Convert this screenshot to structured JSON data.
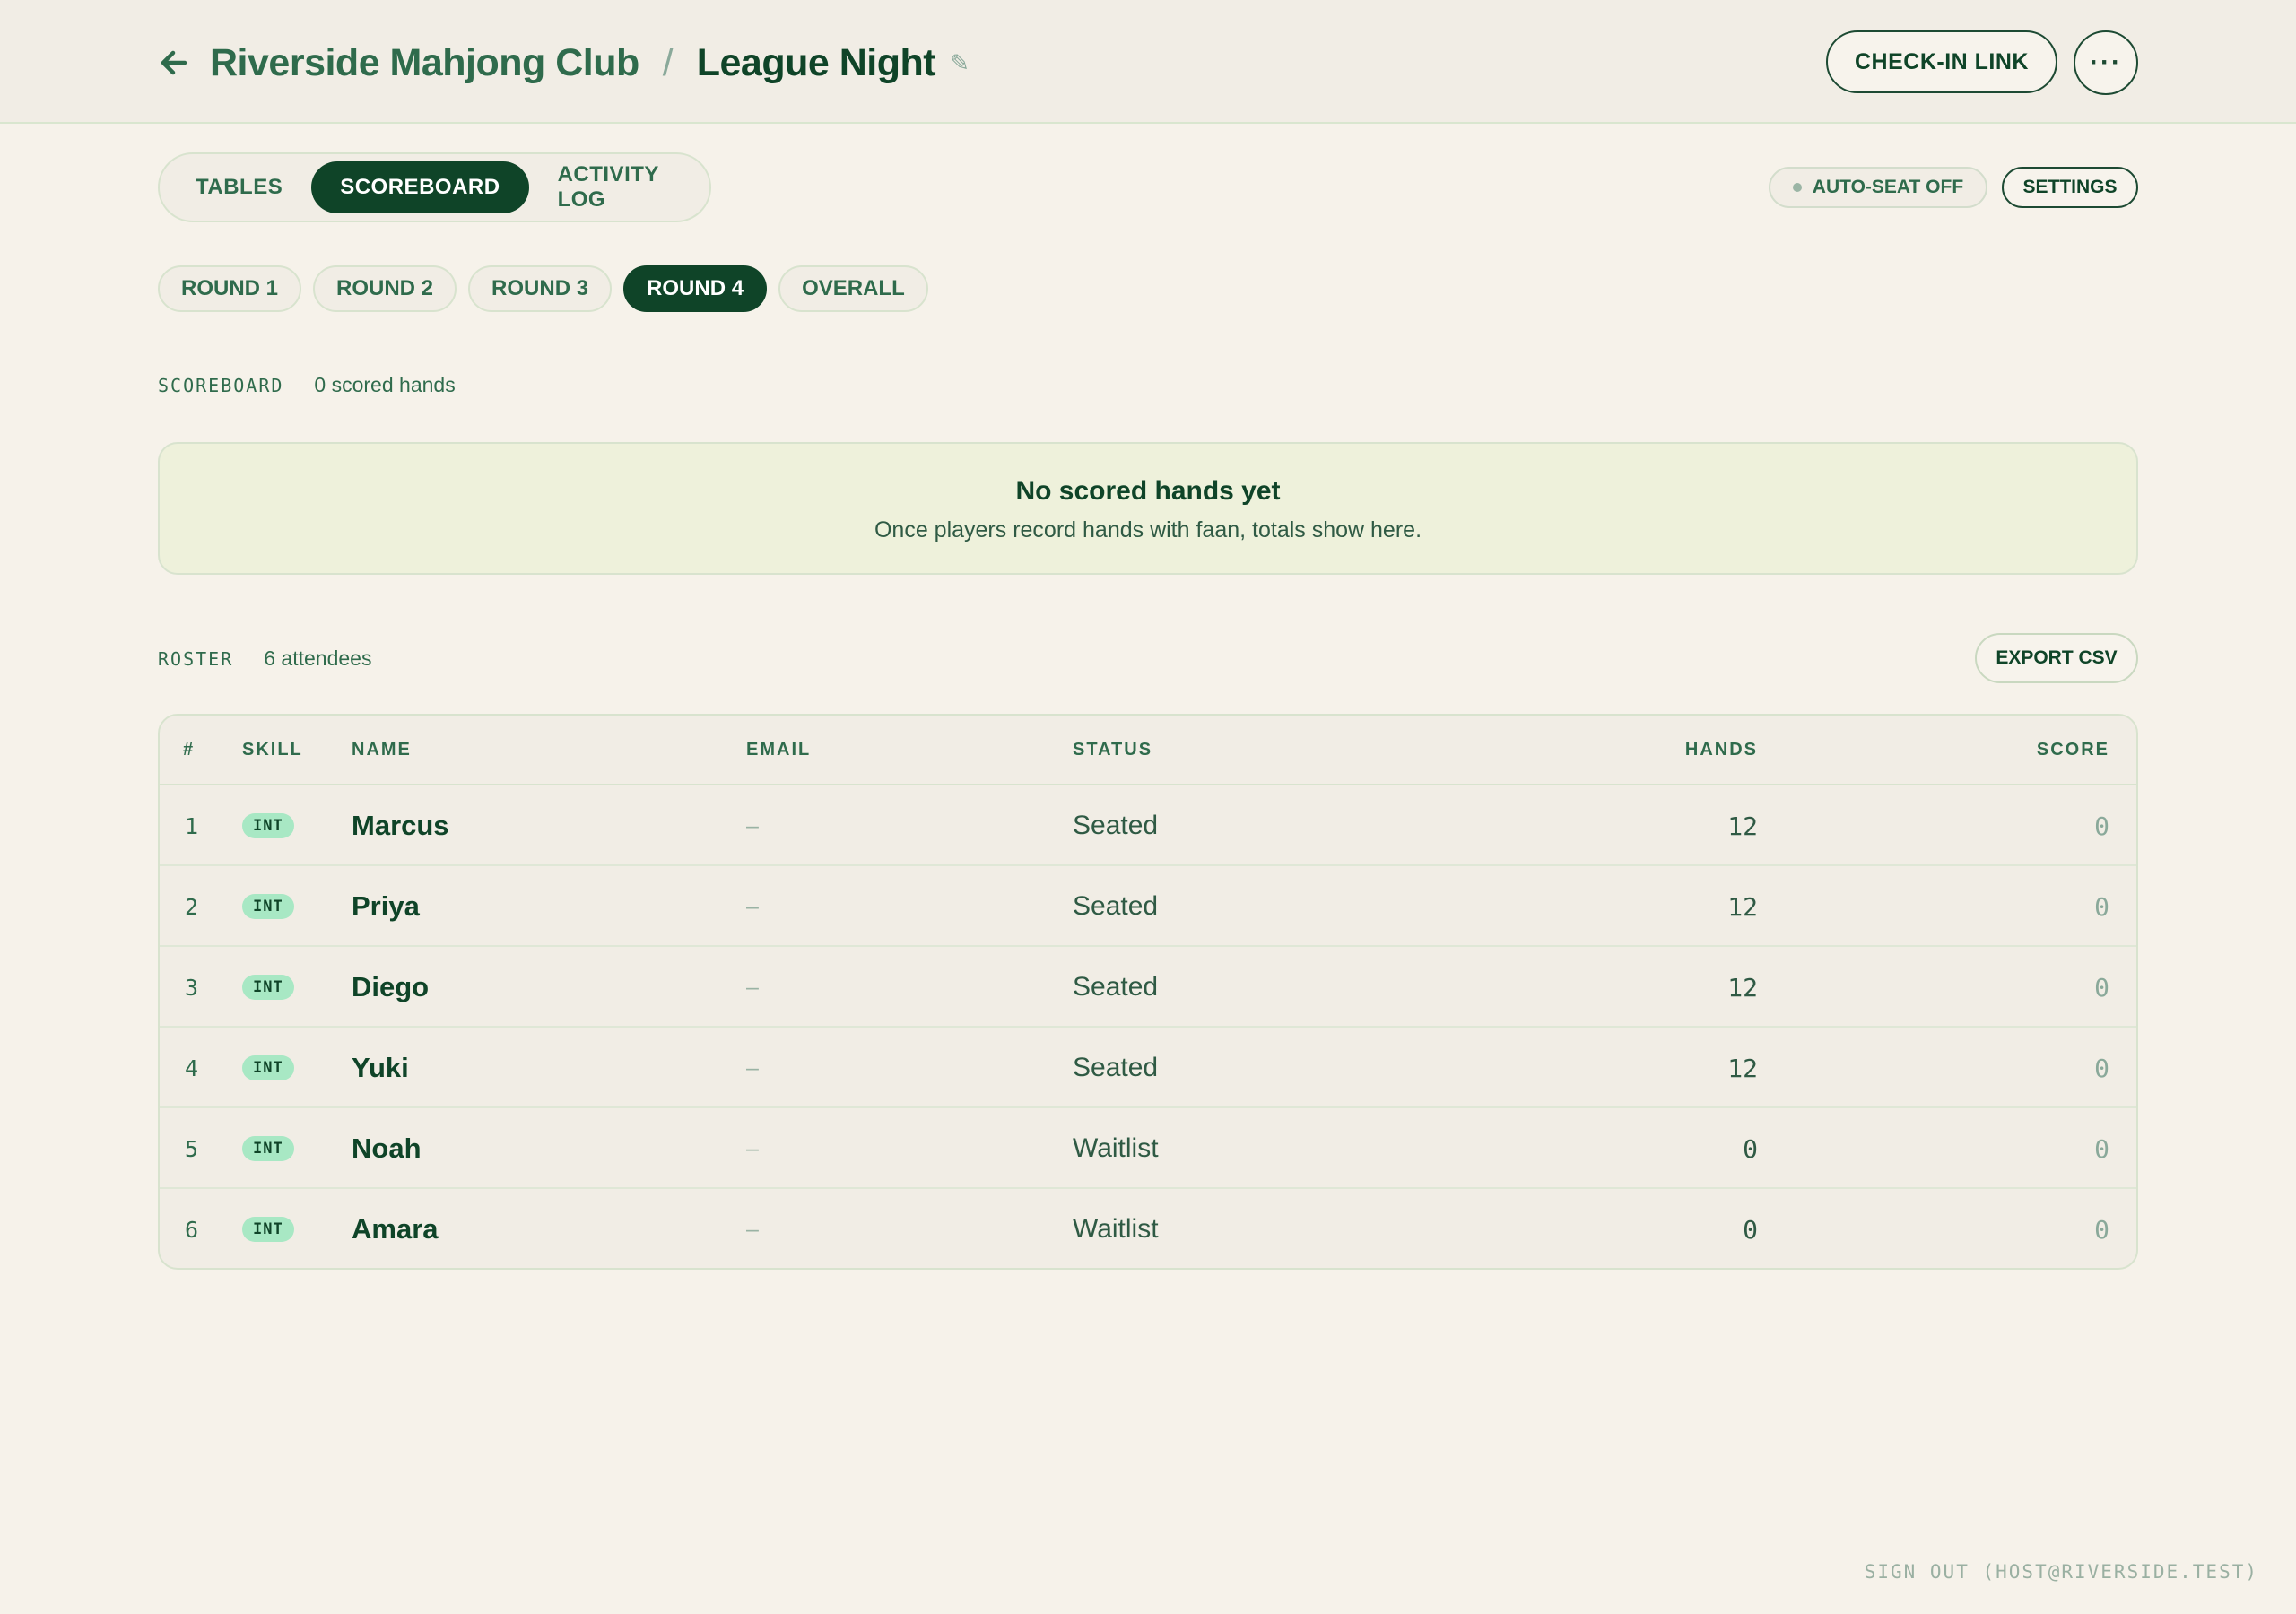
{
  "header": {
    "club": "Riverside Mahjong Club",
    "separator": "/",
    "event": "League Night",
    "checkin_label": "CHECK-IN LINK",
    "more_label": "···"
  },
  "tabs": [
    {
      "label": "TABLES",
      "active": false
    },
    {
      "label": "SCOREBOARD",
      "active": true
    },
    {
      "label": "ACTIVITY LOG",
      "active": false
    }
  ],
  "controls": {
    "autoseat_label": "AUTO-SEAT OFF",
    "settings_label": "SETTINGS"
  },
  "rounds": [
    {
      "label": "ROUND 1",
      "active": false
    },
    {
      "label": "ROUND 2",
      "active": false
    },
    {
      "label": "ROUND 3",
      "active": false
    },
    {
      "label": "ROUND 4",
      "active": true
    },
    {
      "label": "OVERALL",
      "active": false
    }
  ],
  "scoreboard": {
    "label": "SCOREBOARD",
    "count": "0 scored hands",
    "empty_title": "No scored hands yet",
    "empty_sub": "Once players record hands with faan, totals show here."
  },
  "roster": {
    "label": "ROSTER",
    "count": "6 attendees",
    "export_label": "EXPORT CSV",
    "columns": {
      "num": "#",
      "skill": "SKILL",
      "name": "NAME",
      "email": "EMAIL",
      "status": "STATUS",
      "hands": "HANDS",
      "score": "SCORE"
    },
    "rows": [
      {
        "num": "1",
        "skill": "INT",
        "name": "Marcus",
        "email": "–",
        "status": "Seated",
        "hands": "12",
        "score": "0"
      },
      {
        "num": "2",
        "skill": "INT",
        "name": "Priya",
        "email": "–",
        "status": "Seated",
        "hands": "12",
        "score": "0"
      },
      {
        "num": "3",
        "skill": "INT",
        "name": "Diego",
        "email": "–",
        "status": "Seated",
        "hands": "12",
        "score": "0"
      },
      {
        "num": "4",
        "skill": "INT",
        "name": "Yuki",
        "email": "–",
        "status": "Seated",
        "hands": "12",
        "score": "0"
      },
      {
        "num": "5",
        "skill": "INT",
        "name": "Noah",
        "email": "–",
        "status": "Waitlist",
        "hands": "0",
        "score": "0"
      },
      {
        "num": "6",
        "skill": "INT",
        "name": "Amara",
        "email": "–",
        "status": "Waitlist",
        "hands": "0",
        "score": "0"
      }
    ]
  },
  "footer": {
    "signout": "SIGN OUT (HOST@RIVERSIDE.TEST)"
  },
  "icons": {
    "back": "arrow-left-icon",
    "edit": "pencil-icon",
    "more": "ellipsis-icon",
    "autoseat": "dot-icon"
  },
  "colors": {
    "brand": "#0f4428",
    "accent": "#2f6b4c",
    "background": "#f6f2ea",
    "empty_bg": "#eef1db",
    "badge": "#a8e8c4"
  }
}
